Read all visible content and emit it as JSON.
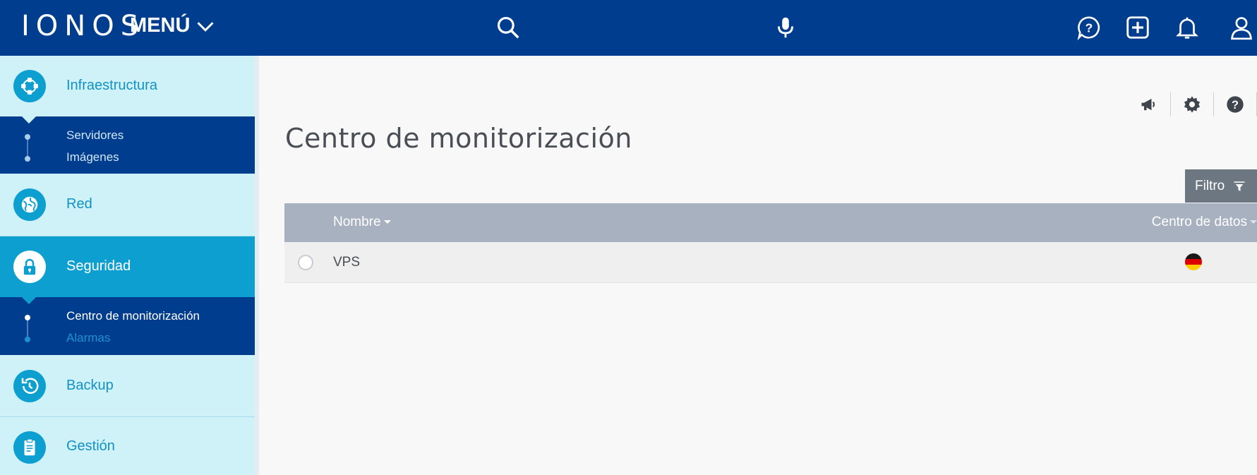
{
  "header": {
    "logo": "IONOS",
    "menu_label": "MENÚ",
    "icons": [
      "search-icon",
      "microphone-icon",
      "help-chat-icon",
      "add-icon",
      "bell-icon",
      "user-icon"
    ]
  },
  "sidebar": {
    "items": [
      {
        "label": "Infraestructura",
        "icon": "network-nodes-icon",
        "active": false
      },
      {
        "label": "Red",
        "icon": "globe-icon",
        "active": false
      },
      {
        "label": "Seguridad",
        "icon": "lock-icon",
        "active": true
      },
      {
        "label": "Backup",
        "icon": "history-clock-icon",
        "active": false
      },
      {
        "label": "Gestión",
        "icon": "clipboard-icon",
        "active": false
      }
    ],
    "infra_sub": [
      "Servidores",
      "Imágenes"
    ],
    "security_sub": [
      "Centro de monitorización",
      "Alarmas"
    ]
  },
  "main": {
    "title": "Centro de monitorización",
    "tool_icons": [
      "megaphone-icon",
      "gear-icon",
      "help-icon"
    ],
    "filter_label": "Filtro",
    "table": {
      "columns": [
        "Nombre",
        "Centro de datos"
      ],
      "rows": [
        {
          "name": "VPS",
          "datacenter": "germany-flag"
        }
      ]
    }
  },
  "colors": {
    "header_bg": "#003d8f",
    "sidebar_bg": "#cff2f9",
    "accent": "#0e9fd1",
    "table_header": "#a7b1c0",
    "filter_bg": "#6c7782"
  }
}
